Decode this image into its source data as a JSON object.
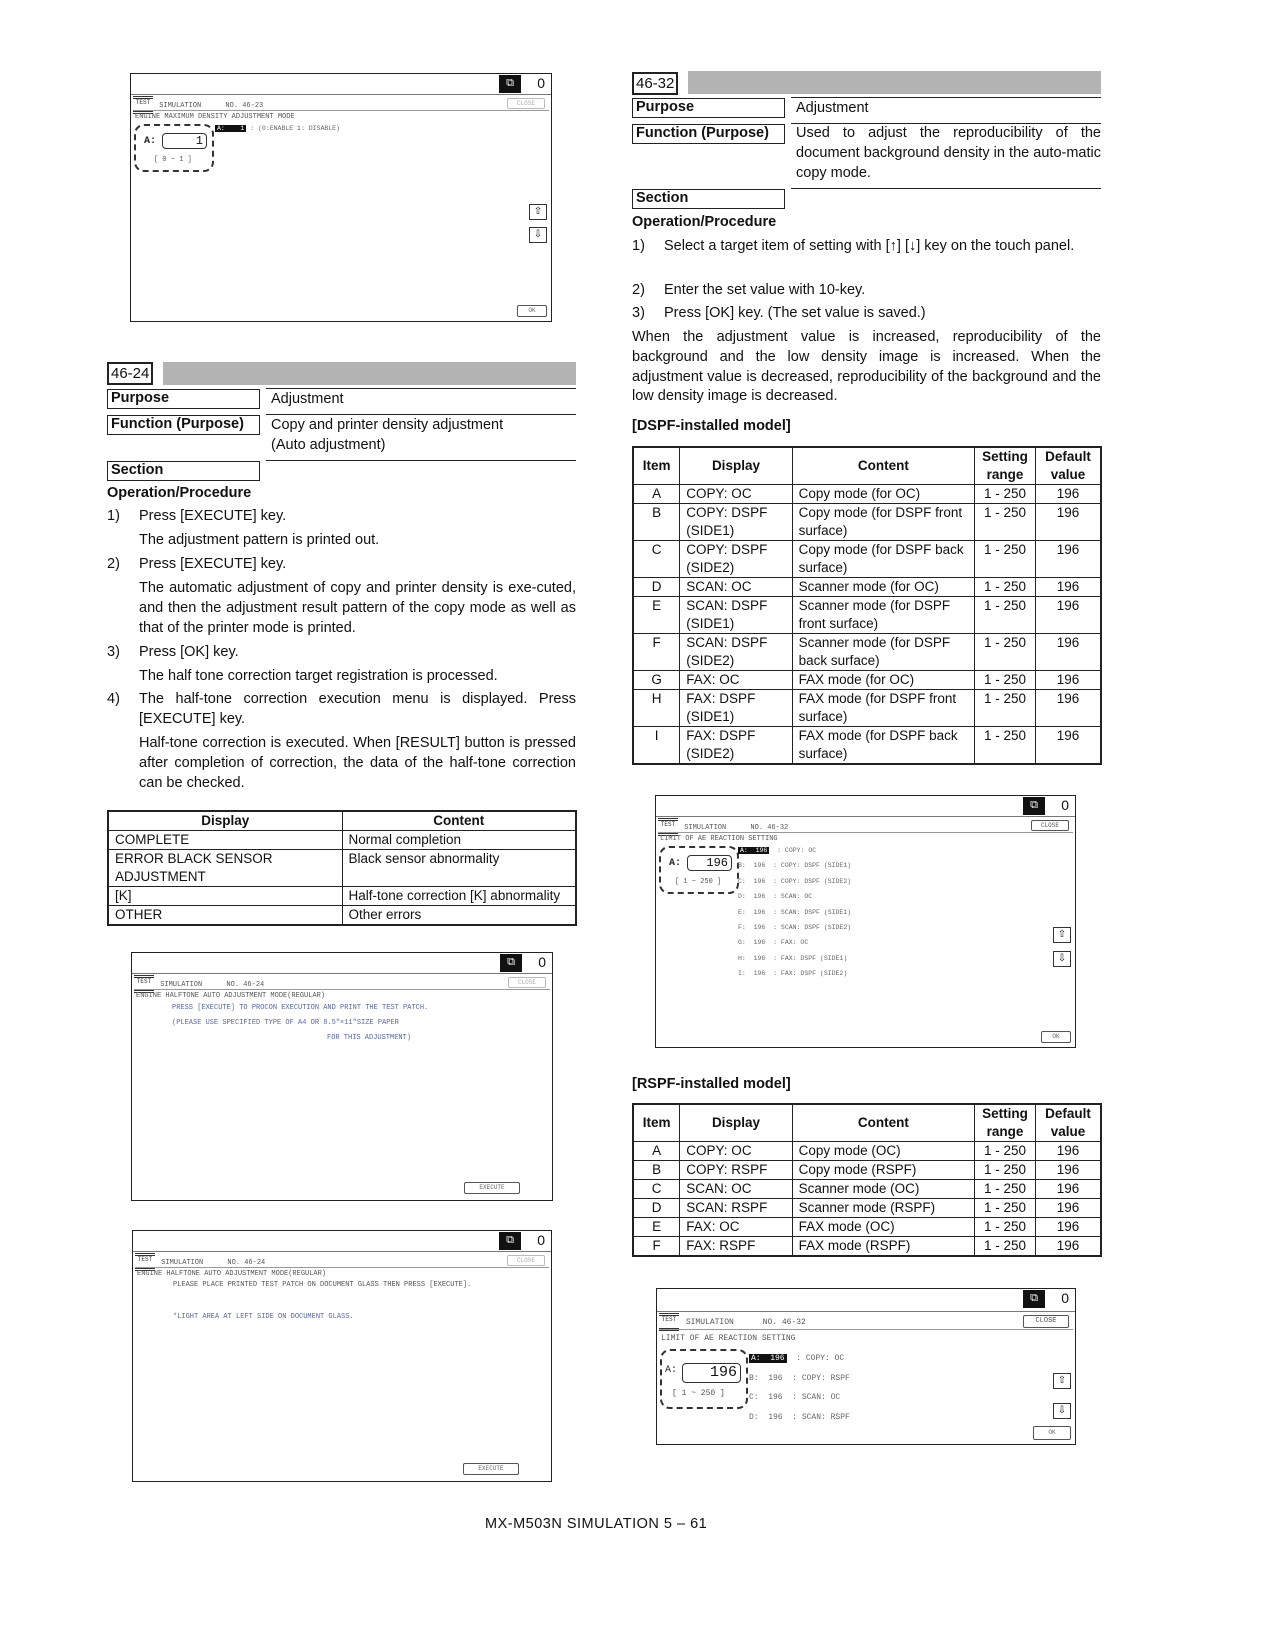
{
  "screen_46_23": {
    "count": "0",
    "test_logo": "TEST",
    "title": "SIMULATION",
    "number": "NO. 46-23",
    "close": "CLOSE",
    "mode": "ENGINE MAXIMUM DENSITY ADJUSTMENT MODE",
    "input_label": "A:",
    "input_value": "1",
    "input_range": "[ 0 ~ 1 ]",
    "row_key": "A:",
    "row_value": "1",
    "row_desc": ": (0:ENABLE  1: DISABLE)",
    "up_icon": "⇧",
    "down_icon": "⇩",
    "ok": "OK"
  },
  "section_46_24": {
    "number": "46-24",
    "purpose_label": "Purpose",
    "purpose_value": "Adjustment",
    "function_label": "Function (Purpose)",
    "function_value_1": "Copy and printer density adjustment",
    "function_value_2": "(Auto adjustment)",
    "section_label": "Section",
    "operation_heading": "Operation/Procedure",
    "steps": [
      {
        "num": "1)",
        "text": "Press [EXECUTE] key."
      },
      {
        "num": "",
        "text": "The adjustment pattern is printed out."
      },
      {
        "num": "2)",
        "text": "Press [EXECUTE] key."
      },
      {
        "num": "",
        "text": "The automatic adjustment of copy and printer density is exe-cuted, and then the adjustment result pattern of the copy mode as well as that of the printer mode is printed."
      },
      {
        "num": "3)",
        "text": "Press [OK] key."
      },
      {
        "num": "",
        "text": "The half tone correction target registration is processed."
      },
      {
        "num": "4)",
        "text": "The half-tone correction execution menu is displayed. Press [EXECUTE] key."
      },
      {
        "num": "",
        "text": "Half-tone correction is executed. When [RESULT] button is pressed after completion of correction, the data of the half-tone correction can be checked."
      }
    ],
    "result_table": {
      "headers": [
        "Display",
        "Content"
      ],
      "rows": [
        [
          "COMPLETE",
          "Normal completion"
        ],
        [
          "ERROR BLACK SENSOR ADJUSTMENT",
          "Black sensor abnormality"
        ],
        [
          "[K]",
          "Half-tone correction [K] abnormality"
        ],
        [
          "OTHER",
          "Other errors"
        ]
      ]
    }
  },
  "screen_46_24_a": {
    "count": "0",
    "test_logo": "TEST",
    "title": "SIMULATION",
    "number": "NO. 46-24",
    "close": "CLOSE",
    "mode": "ENGINE HALFTONE AUTO ADJUSTMENT MODE(REGULAR)",
    "line1": "PRESS [EXECUTE] TO PROCON EXECUTION AND PRINT THE TEST PATCH.",
    "line2": "(PLEASE USE SPECIFIED TYPE OF A4 OR 8.5\"×11\"SIZE PAPER",
    "line3": "FOR THIS ADJUSTMENT)",
    "execute": "EXECUTE"
  },
  "screen_46_24_b": {
    "count": "0",
    "test_logo": "TEST",
    "title": "SIMULATION",
    "number": "NO. 46-24",
    "close": "CLOSE",
    "mode": "ENGINE HALFTONE AUTO ADJUSTMENT MODE(REGULAR)",
    "line1": "PLEASE PLACE PRINTED TEST PATCH ON DOCUMENT GLASS THEN PRESS [EXECUTE].",
    "line2": "*LIGHT AREA AT LEFT SIDE ON DOCUMENT GLASS.",
    "execute": "EXECUTE"
  },
  "section_46_32": {
    "number": "46-32",
    "purpose_label": "Purpose",
    "purpose_value": "Adjustment",
    "function_label": "Function (Purpose)",
    "function_value": "Used to adjust the reproducibility of the document background density in the auto-matic copy mode.",
    "section_label": "Section",
    "operation_heading": "Operation/Procedure",
    "steps": [
      {
        "num": "1)",
        "text": "Select a target item of setting with [↑] [↓] key on the touch panel."
      },
      {
        "num": "2)",
        "text": "Enter the set value with 10-key."
      },
      {
        "num": "3)",
        "text": "Press [OK] key. (The set value is saved.)"
      }
    ],
    "note": "When the adjustment value is increased, reproducibility of the background and the low density image is increased. When the adjustment value is decreased, reproducibility of the background and the low density image is decreased.",
    "dspf_heading": "[DSPF-installed model]",
    "dspf_table": {
      "headers": [
        "Item",
        "Display",
        "Content",
        "Setting range",
        "Default value"
      ],
      "rows": [
        [
          "A",
          "COPY: OC",
          "Copy mode (for OC)",
          "1 - 250",
          "196"
        ],
        [
          "B",
          "COPY: DSPF (SIDE1)",
          "Copy mode (for DSPF front surface)",
          "1 - 250",
          "196"
        ],
        [
          "C",
          "COPY: DSPF (SIDE2)",
          "Copy mode (for DSPF back surface)",
          "1 - 250",
          "196"
        ],
        [
          "D",
          "SCAN: OC",
          "Scanner mode (for OC)",
          "1 - 250",
          "196"
        ],
        [
          "E",
          "SCAN: DSPF (SIDE1)",
          "Scanner mode (for DSPF front surface)",
          "1 - 250",
          "196"
        ],
        [
          "F",
          "SCAN: DSPF (SIDE2)",
          "Scanner mode (for DSPF back surface)",
          "1 - 250",
          "196"
        ],
        [
          "G",
          "FAX: OC",
          "FAX mode (for OC)",
          "1 - 250",
          "196"
        ],
        [
          "H",
          "FAX: DSPF (SIDE1)",
          "FAX mode (for DSPF front surface)",
          "1 - 250",
          "196"
        ],
        [
          "I",
          "FAX: DSPF (SIDE2)",
          "FAX mode (for DSPF back surface)",
          "1 - 250",
          "196"
        ]
      ]
    },
    "rspf_heading": "[RSPF-installed model]",
    "rspf_table": {
      "headers": [
        "Item",
        "Display",
        "Content",
        "Setting range",
        "Default value"
      ],
      "rows": [
        [
          "A",
          "COPY: OC",
          "Copy mode (OC)",
          "1 - 250",
          "196"
        ],
        [
          "B",
          "COPY: RSPF",
          "Copy mode (RSPF)",
          "1 - 250",
          "196"
        ],
        [
          "C",
          "SCAN: OC",
          "Scanner mode (OC)",
          "1 - 250",
          "196"
        ],
        [
          "D",
          "SCAN: RSPF",
          "Scanner mode (RSPF)",
          "1 - 250",
          "196"
        ],
        [
          "E",
          "FAX: OC",
          "FAX mode (OC)",
          "1 - 250",
          "196"
        ],
        [
          "F",
          "FAX: RSPF",
          "FAX mode (RSPF)",
          "1 - 250",
          "196"
        ]
      ]
    }
  },
  "screen_46_32_dspf": {
    "count": "0",
    "test_logo": "TEST",
    "title": "SIMULATION",
    "number": "NO. 46-32",
    "close": "CLOSE",
    "mode": "LIMIT OF AE REACTION SETTING",
    "input_label": "A:",
    "input_value": "196",
    "input_range": "[ 1 ~ 250 ]",
    "rows": [
      {
        "key": "A:",
        "value": "196",
        "desc": ": COPY: OC"
      },
      {
        "key": "B:",
        "value": "196",
        "desc": ": COPY: DSPF (SIDE1)"
      },
      {
        "key": "C:",
        "value": "196",
        "desc": ": COPY: DSPF (SIDE2)"
      },
      {
        "key": "D:",
        "value": "196",
        "desc": ": SCAN: OC"
      },
      {
        "key": "E:",
        "value": "196",
        "desc": ": SCAN: DSPF (SIDE1)"
      },
      {
        "key": "F:",
        "value": "196",
        "desc": ": SCAN: DSPF (SIDE2)"
      },
      {
        "key": "G:",
        "value": "196",
        "desc": ": FAX: OC"
      },
      {
        "key": "H:",
        "value": "196",
        "desc": ": FAX: DSPF (SIDE1)"
      },
      {
        "key": "I:",
        "value": "196",
        "desc": ": FAX: DSPF (SIDE2)"
      }
    ],
    "up_icon": "⇧",
    "down_icon": "⇩",
    "ok": "OK"
  },
  "screen_46_32_rspf": {
    "count": "0",
    "test_logo": "TEST",
    "title": "SIMULATION",
    "number": "NO. 46-32",
    "close": "CLOSE",
    "mode": "LIMIT OF AE REACTION SETTING",
    "input_label": "A:",
    "input_value": "196",
    "input_range": "[ 1 ~ 250 ]",
    "rows": [
      {
        "key": "A:",
        "value": "196",
        "desc": ": COPY: OC"
      },
      {
        "key": "B:",
        "value": "196",
        "desc": ": COPY: RSPF"
      },
      {
        "key": "C:",
        "value": "196",
        "desc": ": SCAN: OC"
      },
      {
        "key": "D:",
        "value": "196",
        "desc": ": SCAN: RSPF"
      }
    ],
    "up_icon": "⇧",
    "down_icon": "⇩",
    "ok": "OK"
  },
  "footer": "MX-M503N  SIMULATION  5 – 61"
}
